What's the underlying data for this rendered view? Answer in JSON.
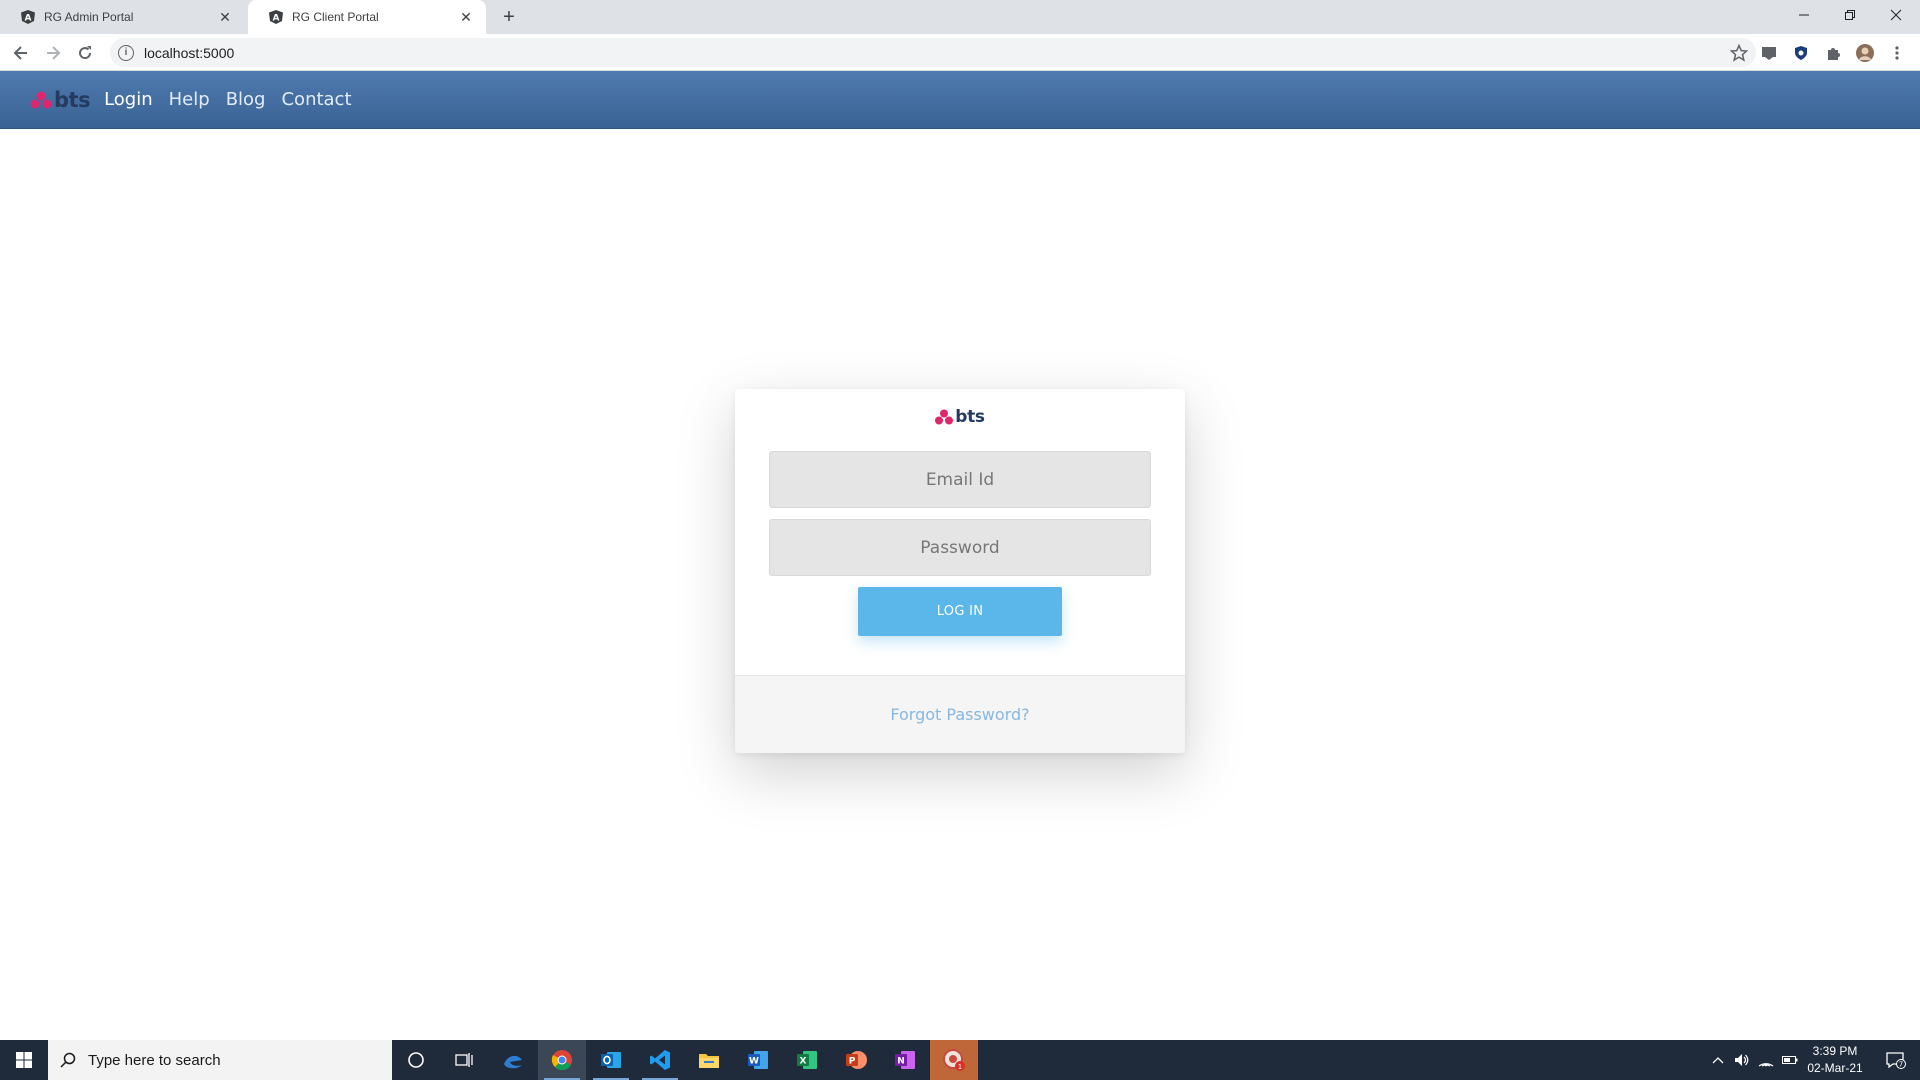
{
  "browser": {
    "tabs": [
      {
        "title": "RG Admin Portal",
        "active": false,
        "icon": "angular-icon"
      },
      {
        "title": "RG Client Portal",
        "active": true,
        "icon": "angular-icon"
      }
    ],
    "url": "localhost:5000"
  },
  "navbar": {
    "brand": "bts",
    "links": [
      {
        "label": "Login",
        "active": true
      },
      {
        "label": "Help",
        "active": false
      },
      {
        "label": "Blog",
        "active": false
      },
      {
        "label": "Contact",
        "active": false
      }
    ],
    "background": "#4a75a8"
  },
  "login_card": {
    "brand": "bts",
    "email_placeholder": "Email Id",
    "password_placeholder": "Password",
    "login_button": "LOG IN",
    "forgot_link": "Forgot Password?",
    "accent": "#5bb7ea",
    "logo_dot_color": "#e0256a"
  },
  "taskbar": {
    "search_placeholder": "Type here to search",
    "time": "3:39 PM",
    "date": "02-Mar-21",
    "notification_count": "7",
    "apps": [
      "cortana-icon",
      "task-view-icon",
      "edge-legacy-icon",
      "chrome-icon",
      "outlook-icon",
      "vscode-icon",
      "file-explorer-icon",
      "word-icon",
      "excel-icon",
      "powerpoint-icon",
      "onenote-icon",
      "app-icon"
    ]
  }
}
